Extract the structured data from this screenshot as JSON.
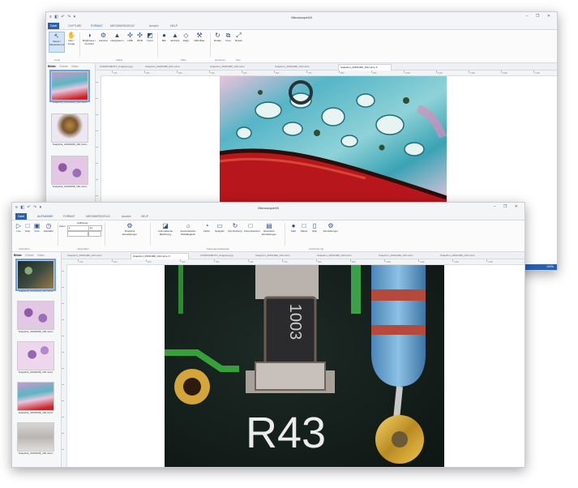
{
  "window_back": {
    "title": "MicroscopeX8",
    "quick_access": "≡ ◧ ↶ ↷ ▾",
    "controls": "–  ❐  ✕",
    "tabs": [
      {
        "label": "Datei"
      },
      {
        "label": "CAPTURE"
      },
      {
        "label": "FORMAT"
      },
      {
        "label": "MESSWERKZEUG"
      },
      {
        "label": "Ansicht"
      },
      {
        "label": "HELP"
      }
    ],
    "ribbon_buttons": [
      {
        "label": "Select / Measurement",
        "icon": "cursor-icon"
      },
      {
        "label": "Pan / Image",
        "icon": "hand-icon"
      },
      {
        "label": "Brightness / Contrast",
        "icon": "brightness-icon"
      },
      {
        "label": "Gamma",
        "icon": "gamma-icon"
      },
      {
        "label": "Histogramm",
        "icon": "histogram-icon"
      },
      {
        "label": "HSB",
        "icon": "hsb-icon"
      },
      {
        "label": "RGB",
        "icon": "rgb-icon"
      },
      {
        "label": "Invert",
        "icon": "invert-icon"
      },
      {
        "label": "Blur",
        "icon": "blur-icon"
      },
      {
        "label": "Emboss",
        "icon": "emboss-icon"
      },
      {
        "label": "Edge",
        "icon": "edge-icon"
      },
      {
        "label": "Mikrofilter",
        "icon": "filter-icon"
      },
      {
        "label": "Rotate",
        "icon": "rotate-icon"
      },
      {
        "label": "Crop",
        "icon": "crop-icon"
      },
      {
        "label": "Resize",
        "icon": "resize-icon"
      }
    ],
    "group_labels": [
      "Tools",
      "Adjust",
      "Filter",
      "Geometry",
      "Size"
    ],
    "doc_tabs": [
      {
        "label": "COMPONENTS_Snapshot.jpg"
      },
      {
        "label": "Snapshot_20151008_001.micro"
      },
      {
        "label": "Snapshot_20151008_130.micro"
      },
      {
        "label": "Snapshot_20151008_130.micro"
      },
      {
        "label": "Snapshot_20151008_130.micro ✕"
      }
    ],
    "side_tabs": [
      "Bilder",
      "Ordner",
      "Video"
    ],
    "thumbnails": [
      {
        "caption": "Snapshot_20151008_130.micro"
      },
      {
        "caption": "Snapshot_20151008_130.micro"
      },
      {
        "caption": "Snapshot_20151008_130.micro"
      }
    ],
    "ruler_labels": [
      "100",
      "200",
      "300",
      "400",
      "500",
      "600",
      "700",
      "800",
      "900",
      "1000",
      "1100",
      "1200",
      "1300",
      "1400"
    ],
    "zoom": "100%"
  },
  "window_front": {
    "title": "MicroscopeX8",
    "quick_access": "≡ ◧ ↶ ↷ ▾",
    "controls": "–  ❐  ✕",
    "tabs": [
      {
        "label": "Datei"
      },
      {
        "label": "AUFNAHME"
      },
      {
        "label": "FORMAT"
      },
      {
        "label": "MESSWERKZEUG"
      },
      {
        "label": "Ansicht"
      },
      {
        "label": "HELP"
      }
    ],
    "ribbon_buttons": [
      {
        "label": "Live",
        "icon": "play-icon"
      },
      {
        "label": "Stop",
        "icon": "stop-icon"
      },
      {
        "label": "Foto",
        "icon": "camera-icon"
      },
      {
        "label": "Zeitraffer",
        "icon": "timer-icon"
      },
      {
        "label": "Snapshot Einstellungen",
        "icon": "settings-icon"
      },
      {
        "label": "Automatische Belichtung",
        "icon": "exposure-icon"
      },
      {
        "label": "Automatischer Weißabgleich",
        "icon": "white-balance-icon"
      },
      {
        "label": "Farbe",
        "icon": "color-icon"
      },
      {
        "label": "Spiegeln",
        "icon": "mirror-icon"
      },
      {
        "label": "Flip Drehung",
        "icon": "flip-icon"
      },
      {
        "label": "Zuruecksetzen",
        "icon": "reset-icon"
      },
      {
        "label": "Erweiterte Einstellungen",
        "icon": "advanced-icon"
      },
      {
        "label": "Start",
        "icon": "record-icon"
      },
      {
        "label": "Pause",
        "icon": "pause-icon"
      },
      {
        "label": "Stop",
        "icon": "stop-square-icon"
      },
      {
        "label": "Einstellungen",
        "icon": "settings-icon"
      }
    ],
    "zoom_field": {
      "label": "Zoom",
      "value": "1",
      "unit": "1x"
    },
    "resolution_label": "Auflösung",
    "group_labels": [
      "Aufnahme",
      "Vergrößern",
      "Kameraeinstellungen",
      "Aufzeichnung"
    ],
    "doc_tabs": [
      {
        "label": "Snapshot_20151008_130.micro"
      },
      {
        "label": "Snapshot_20151008_130.micro ✕"
      },
      {
        "label": "COMPONENTS_Snapshot.jpg"
      },
      {
        "label": "Snapshot_20151008_130.micro"
      },
      {
        "label": "Snapshot_20151008_130.micro"
      },
      {
        "label": "Snapshot_20151008_130.micro"
      },
      {
        "label": "Snapshot_20151008_130.micro"
      }
    ],
    "side_tabs": [
      "Bilder",
      "Ordner",
      "Video"
    ],
    "thumbnails": [
      {
        "caption": "Snapshot_20151008_130.micro"
      },
      {
        "caption": "Snapshot_20151008_130.micro"
      },
      {
        "caption": "Snapshot_20151008_130.micro"
      },
      {
        "caption": "Snapshot_20151008_130.micro"
      },
      {
        "caption": "Snapshot_20151008_130.micro"
      }
    ],
    "ruler_labels": [
      "100",
      "200",
      "300",
      "400",
      "500",
      "600",
      "700",
      "800",
      "900",
      "1000",
      "1100",
      "1200",
      "1300"
    ],
    "image_text": "R43",
    "resistor_text": "1003"
  },
  "colors": {
    "accent": "#2b5fae",
    "selection": "#d3e3f7"
  }
}
